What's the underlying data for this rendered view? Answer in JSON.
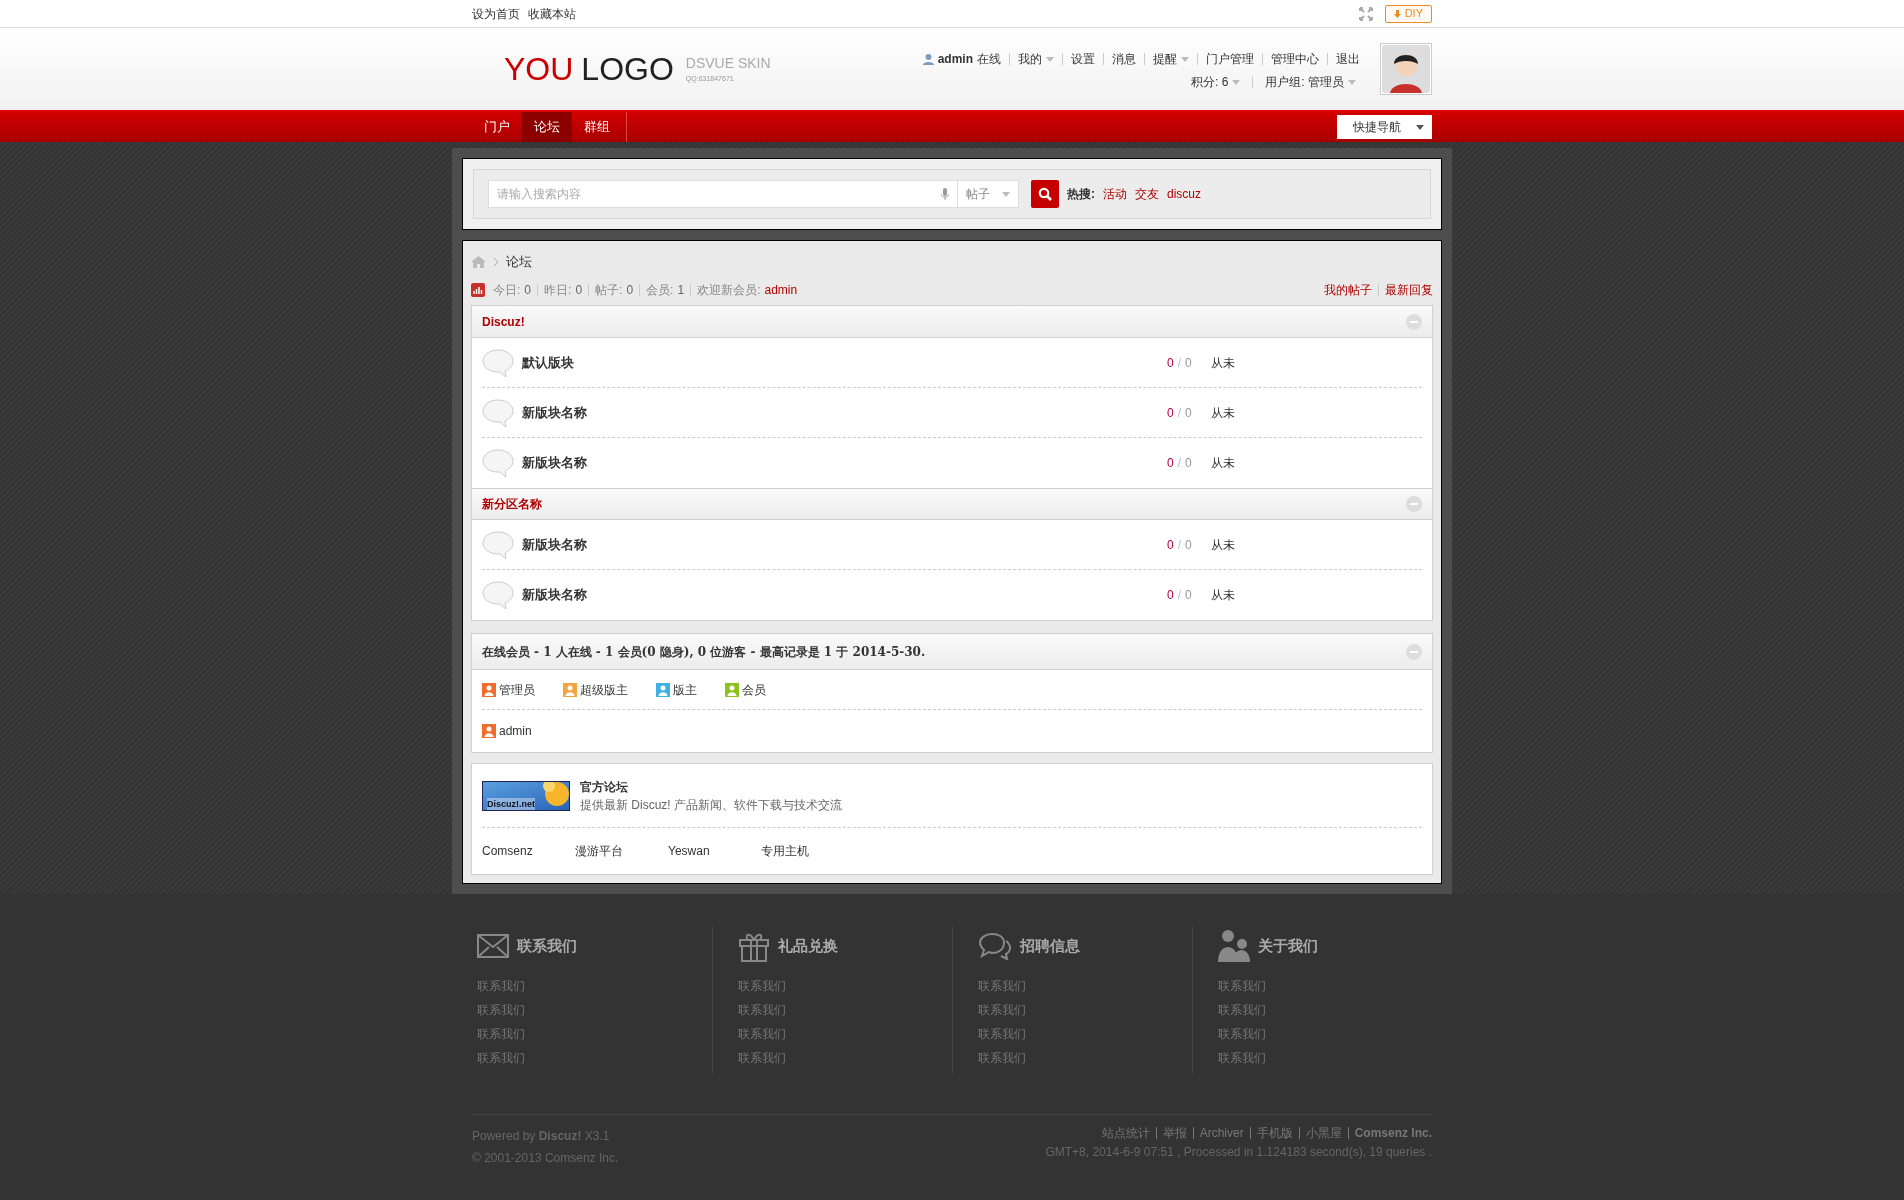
{
  "topbar": {
    "links": [
      "设为首页",
      "收藏本站"
    ],
    "diy_button": "DIY"
  },
  "header": {
    "logo_red": "YOU",
    "logo_dark": "LOGO",
    "skin_title": "DSVUE SKIN",
    "skin_qq": "QQ:631847671",
    "user": {
      "name": "admin",
      "status": "在线"
    },
    "user_links": [
      {
        "label": "我的",
        "dropdown": true
      },
      {
        "label": "设置",
        "dropdown": false
      },
      {
        "label": "消息",
        "dropdown": false
      },
      {
        "label": "提醒",
        "dropdown": true
      },
      {
        "label": "门户管理",
        "dropdown": false
      },
      {
        "label": "管理中心",
        "dropdown": false
      },
      {
        "label": "退出",
        "dropdown": false
      }
    ],
    "user_info": [
      {
        "label": "积分: 6",
        "dropdown": true
      },
      {
        "label": "用户组: 管理员",
        "dropdown": true
      }
    ]
  },
  "nav": {
    "items": [
      {
        "label": "门户",
        "selected": false
      },
      {
        "label": "论坛",
        "selected": true
      },
      {
        "label": "群组",
        "selected": false
      }
    ],
    "quick_nav": "快捷导航"
  },
  "search": {
    "placeholder": "请输入搜索内容",
    "type": "帖子",
    "hot_label": "热搜:",
    "hot": [
      "活动",
      "交友",
      "discuz"
    ]
  },
  "breadcrumb": [
    "论坛"
  ],
  "stats": [
    {
      "label": "今日:",
      "value": "0"
    },
    {
      "label": "昨日:",
      "value": "0"
    },
    {
      "label": "帖子:",
      "value": "0"
    },
    {
      "label": "会员:",
      "value": "1"
    },
    {
      "label": "欢迎新会员:",
      "value": "admin"
    }
  ],
  "stats_links": [
    "我的帖子",
    "最新回复"
  ],
  "categories": [
    {
      "title": "Discuz!",
      "expanded": true,
      "forums": [
        {
          "name": "默认版块",
          "threads": "0",
          "separator": "/",
          "posts": "0",
          "last": "从未"
        },
        {
          "name": "新版块名称",
          "threads": "0",
          "separator": "/",
          "posts": "0",
          "last": "从未"
        },
        {
          "name": "新版块名称",
          "threads": "0",
          "separator": "/",
          "posts": "0",
          "last": "从未"
        }
      ]
    },
    {
      "title": "新分区名称",
      "expanded": true,
      "forums": [
        {
          "name": "新版块名称",
          "threads": "0",
          "separator": "/",
          "posts": "0",
          "last": "从未"
        },
        {
          "name": "新版块名称",
          "threads": "0",
          "separator": "/",
          "posts": "0",
          "last": "从未"
        }
      ]
    }
  ],
  "online": {
    "title": "在线会员",
    "summary": "- 1 人在线 - 1 会员(0 隐身), 0 位游客 - 最高记录是 1 于 2014-5-30.",
    "expanded": true,
    "groups": [
      {
        "label": "管理员",
        "color": "#f26c2b"
      },
      {
        "label": "超级版主",
        "color": "#f4a340"
      },
      {
        "label": "版主",
        "color": "#3fb0e3"
      },
      {
        "label": "会员",
        "color": "#8cc21d"
      }
    ],
    "users": [
      {
        "name": "admin",
        "color": "#f26c2b"
      }
    ]
  },
  "links": {
    "featured": {
      "logo_text": "Discuz!.net",
      "title": "官方论坛",
      "description": "提供最新 Discuz! 产品新闻、软件下载与技术交流"
    },
    "text_links": [
      "Comsenz",
      "漫游平台",
      "Yeswan",
      "专用主机"
    ]
  },
  "footer_columns": [
    {
      "title": "联系我们",
      "links": [
        "联系我们",
        "联系我们",
        "联系我们",
        "联系我们"
      ]
    },
    {
      "title": "礼品兑换",
      "links": [
        "联系我们",
        "联系我们",
        "联系我们",
        "联系我们"
      ]
    },
    {
      "title": "招聘信息",
      "links": [
        "联系我们",
        "联系我们",
        "联系我们",
        "联系我们"
      ]
    },
    {
      "title": "关于我们",
      "links": [
        "联系我们",
        "联系我们",
        "联系我们",
        "联系我们"
      ]
    }
  ],
  "footer": {
    "powered": "Powered by **Discuz!** X3.1",
    "copyright": "© 2001-2013 Comsenz Inc.",
    "links": [
      {
        "label": "站点统计",
        "bold": false
      },
      {
        "label": "举报",
        "bold": false
      },
      {
        "label": "Archiver",
        "bold": false
      },
      {
        "label": "手机版",
        "bold": false
      },
      {
        "label": "小黑屋",
        "bold": false
      },
      {
        "label": "Comsenz Inc.",
        "bold": true
      }
    ],
    "debug": "GMT+8, 2014-6-9 07:51 , Processed in 1.124183 second(s), 19 queries ."
  }
}
